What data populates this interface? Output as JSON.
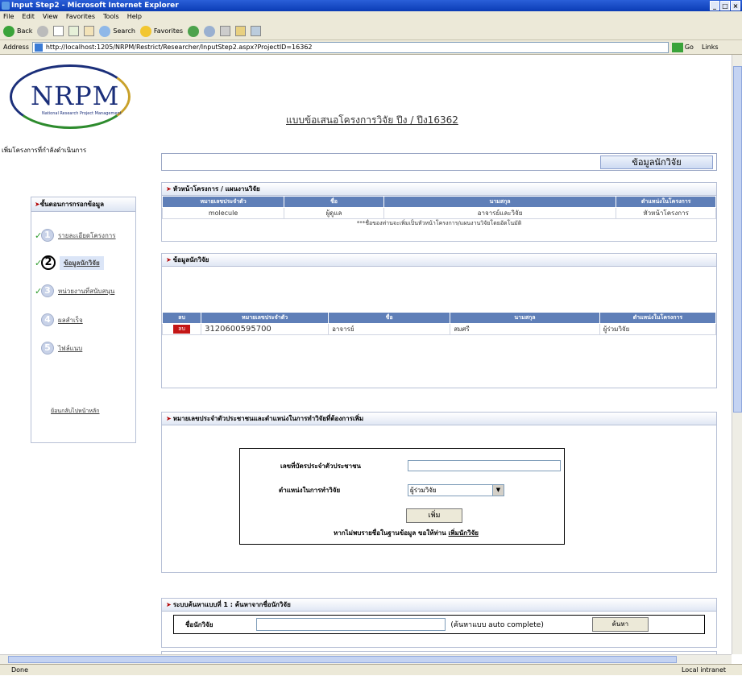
{
  "window": {
    "title": "Input Step2 - Microsoft Internet Explorer",
    "min": "_",
    "restore": "□",
    "close": "×"
  },
  "menu": [
    "File",
    "Edit",
    "View",
    "Favorites",
    "Tools",
    "Help"
  ],
  "toolbar": {
    "back": "Back",
    "search": "Search",
    "favorites": "Favorites"
  },
  "address": {
    "label": "Address",
    "url": "http://localhost:1205/NRPM/Restrict/Researcher/InputStep2.aspx?ProjectID=16362",
    "go": "Go",
    "links": "Links"
  },
  "status": {
    "left": "Done",
    "zone": "Local intranet"
  },
  "header": {
    "logo": "NRPM",
    "logo_sub": "National Research Project Management",
    "title": "แบบข้อเสนอโครงการวิจัย ปีง / ปีง16362",
    "left_note": "เพิ่มโครงการที่กำลังดำเนินการ"
  },
  "tab": "ข้อมูลนักวิจัย",
  "sidebar": {
    "head": "ขั้นตอนการกรอกข้อมูล",
    "steps": [
      {
        "num": "1",
        "label": "รายละเอียดโครงการ",
        "done": true
      },
      {
        "num": "2",
        "label": "ข้อมูลนักวิจัย",
        "done": true
      },
      {
        "num": "3",
        "label": "หน่วยงานที่สนับสนุน",
        "done": true
      },
      {
        "num": "4",
        "label": "ผลสำเร็จ",
        "done": false
      },
      {
        "num": "5",
        "label": "ไฟล์แนบ",
        "done": false
      }
    ],
    "link": "ย้อนกลับไปหน้าหลัก"
  },
  "leader_panel": {
    "title": "หัวหน้าโครงการ / แผนงานวิจัย",
    "headers": [
      "หมายเลขประจำตัว",
      "ชื่อ",
      "นามสกุล",
      "ตำแหน่งในโครงการ"
    ],
    "row": [
      "molecule",
      "ผู้ดูแล",
      "อาจารย์และวิจัย",
      "หัวหน้าโครงการ"
    ],
    "note": "***ชื่อของท่านจะเพิ่มเป็นหัวหน้าโครงการ/แผนงานวิจัยโดยอัตโนมัติ"
  },
  "researcher_panel": {
    "title": "ข้อมูลนักวิจัย",
    "headers": [
      "ลบ",
      "หมายเลขประจำตัว",
      "ชื่อ",
      "นามสกุล",
      "ตำแหน่งในโครงการ"
    ],
    "row": {
      "del": "ลบ",
      "id": "3120600595700",
      "first": "อาจารย์",
      "last": "สมศรี",
      "role": "ผู้ร่วมวิจัย"
    }
  },
  "add_panel": {
    "title": "หมายเลขประจำตัวประชาชนและตำแหน่งในการทำวิจัยที่ต้องการเพิ่ม",
    "id_label": "เลขที่บัตรประจำตัวประชาชน",
    "role_label": "ตำแหน่งในการทำวิจัย",
    "role_value": "ผู้ร่วมวิจัย",
    "add_btn": "เพิ่ม",
    "hint": "หากไม่พบรายชื่อในฐานข้อมูล ขอให้ท่าน ",
    "hint_link": "เพิ่มนักวิจัย"
  },
  "search_panel": {
    "title": "ระบบค้นหาแบบที่ 1 : ค้นหาจากชื่อนักวิจัย",
    "label": "ชื่อนักวิจัย",
    "hint": "(ค้นหาแบบ auto complete)",
    "btn": "ค้นหา"
  }
}
